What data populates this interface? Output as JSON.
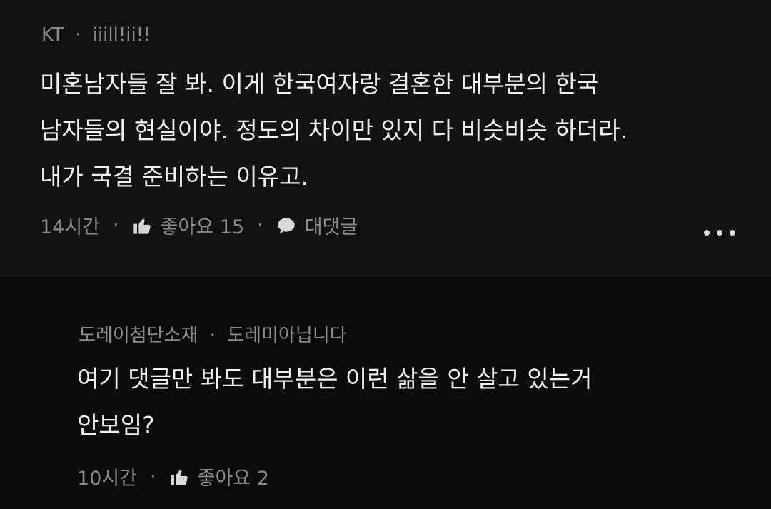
{
  "comments": [
    {
      "author": "KT",
      "subtitle": "iiill!ii!!",
      "separator": "·",
      "lines": [
        "미혼남자들 잘 봐. 이게 한국여자랑 결혼한 대부분의 한국",
        "남자들의 현실이야. 정도의 차이만 있지 다 비슷비슷 하더라.",
        "내가 국결 준비하는 이유고."
      ],
      "time": "14시간",
      "like_label": "좋아요 15",
      "reply_label": "대댓글",
      "dot": "·"
    },
    {
      "author": "도레이첨단소재",
      "subtitle": "도레미아닙니다",
      "separator": "·",
      "lines": [
        "여기 댓글만 봐도 대부분은 이런 삶을 안 살고 있는거",
        "안보임?"
      ],
      "time": "10시간",
      "like_label": "좋아요 2",
      "dot": "·"
    }
  ],
  "icons": {
    "like": "thumbs-up-icon",
    "reply": "speech-bubble-icon",
    "more": "more-dots-icon"
  }
}
